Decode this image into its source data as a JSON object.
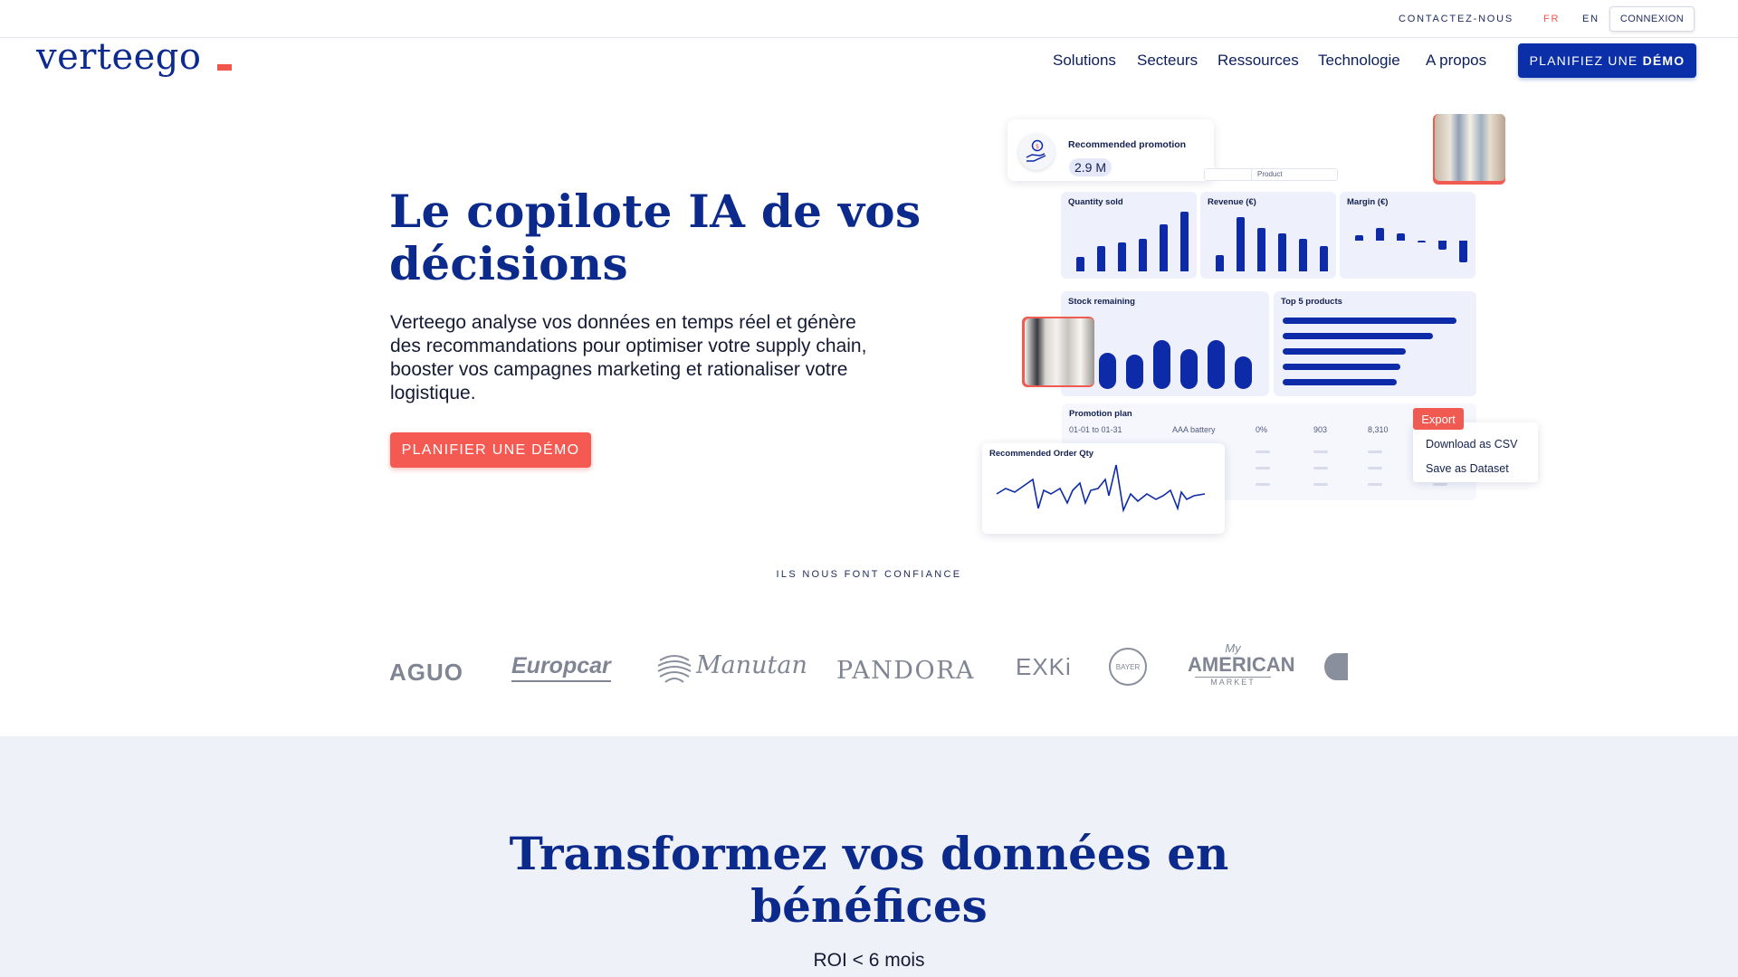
{
  "utility": {
    "contact": "CONTACTEZ-NOUS",
    "lang_fr": "FR",
    "lang_en": "EN",
    "login": "CONNEXION"
  },
  "brand": {
    "logo": "verteego",
    "accent": "#f0564b",
    "primary": "#0b2fa8"
  },
  "nav": {
    "items": [
      "Solutions",
      "Secteurs",
      "Ressources",
      "Technologie",
      "A propos"
    ],
    "cta_prefix": "PLANIFIEZ UNE ",
    "cta_bold": "DÉMO"
  },
  "hero": {
    "title": "Le copilote IA de vos décisions",
    "text": "Verteego analyse vos données en temps réel et génère des recommandations pour optimiser votre supply chain, booster vos campagnes marketing et rationaliser votre logistique.",
    "cta": "PLANIFIER UNE DÉMO"
  },
  "dashboard": {
    "promo_label": "Recommended promotion",
    "promo_value": "2.9 M",
    "filter_product": "Product",
    "quantity_title": "Quantity sold",
    "revenue_title": "Revenue (€)",
    "margin_title": "Margin (€)",
    "stock_title": "Stock remaining",
    "top_title": "Top 5 products",
    "plan_title": "Promotion plan",
    "plan_row": [
      "01-01 to 01-31",
      "AAA battery",
      "0%",
      "903",
      "8,310"
    ],
    "export_label": "Export",
    "export_csv": "Download as CSV",
    "export_dataset": "Save as Dataset",
    "order_title": "Recommended Order Qty",
    "icon_promo": "hand-coin-icon"
  },
  "trust": {
    "title": "ILS NOUS FONT CONFIANCE",
    "logos": [
      "AGUO",
      "Europcar",
      "Manutan",
      "PANDORA",
      "EXKi",
      "BAYER",
      "My",
      "AMERICAN",
      "MARKET"
    ]
  },
  "section2": {
    "title": "Transformez vos données en bénéfices",
    "subtitle": "ROI < 6 mois"
  }
}
